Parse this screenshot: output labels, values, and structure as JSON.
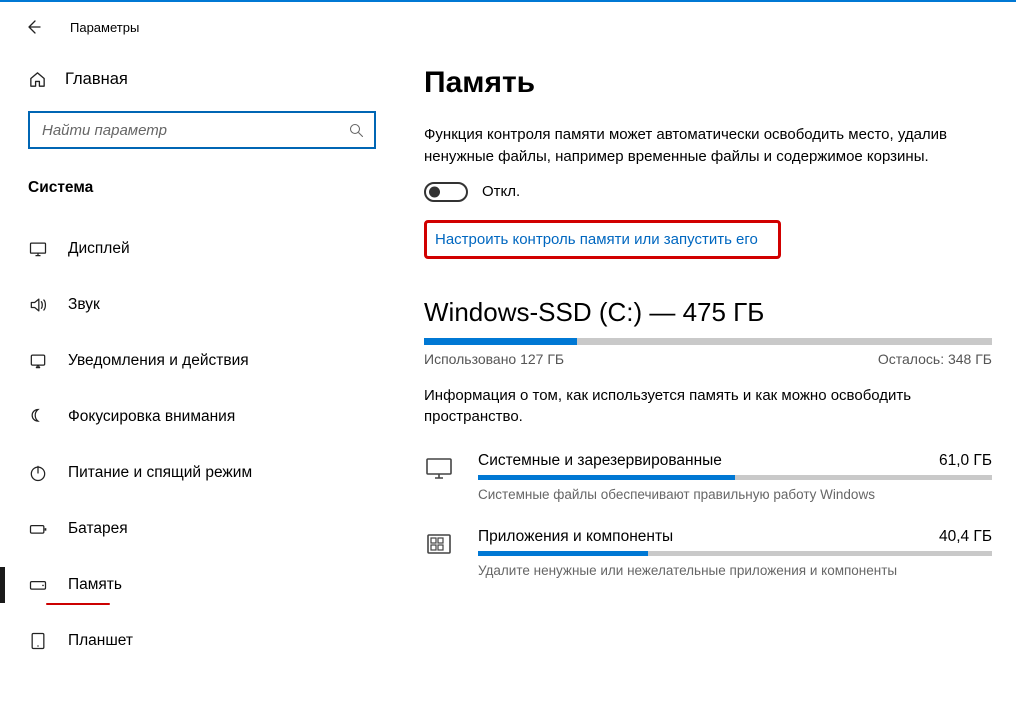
{
  "titlebar": {
    "title": "Параметры"
  },
  "sidebar": {
    "home": "Главная",
    "search_placeholder": "Найти параметр",
    "category": "Система",
    "items": [
      {
        "icon": "display",
        "label": "Дисплей"
      },
      {
        "icon": "sound",
        "label": "Звук"
      },
      {
        "icon": "notify",
        "label": "Уведомления и действия"
      },
      {
        "icon": "focus",
        "label": "Фокусировка внимания"
      },
      {
        "icon": "power",
        "label": "Питание и спящий режим"
      },
      {
        "icon": "battery",
        "label": "Батарея"
      },
      {
        "icon": "storage",
        "label": "Память",
        "selected": true
      },
      {
        "icon": "tablet",
        "label": "Планшет"
      }
    ]
  },
  "content": {
    "title": "Память",
    "storage_sense_desc": "Функция контроля памяти может автоматически освободить место, удалив ненужные файлы, например временные файлы и содержимое корзины.",
    "toggle_state": "Откл.",
    "config_link": "Настроить контроль памяти или запустить его",
    "drive": {
      "label": "Windows-SSD (C:) — 475 ГБ",
      "fill_percent": 27,
      "used_label": "Использовано 127 ГБ",
      "free_label": "Осталось: 348 ГБ",
      "info": "Информация о том, как используется память и как можно освободить пространство."
    },
    "categories": [
      {
        "icon": "system",
        "name": "Системные и зарезервированные",
        "size": "61,0 ГБ",
        "fill": 50,
        "sub": "Системные файлы обеспечивают правильную работу Windows"
      },
      {
        "icon": "apps",
        "name": "Приложения и компоненты",
        "size": "40,4 ГБ",
        "fill": 33,
        "sub": "Удалите ненужные или нежелательные приложения и компоненты"
      }
    ]
  }
}
